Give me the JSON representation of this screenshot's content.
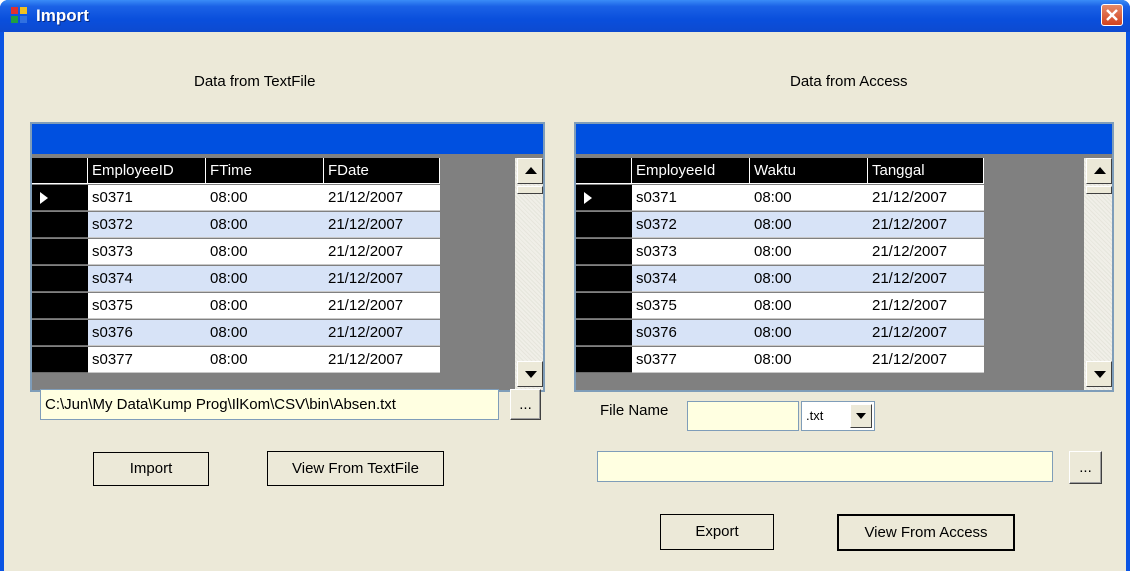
{
  "window": {
    "title": "Import"
  },
  "left": {
    "caption": "Data from TextFile",
    "columns": [
      "EmployeeID",
      "FTime",
      "FDate"
    ],
    "rows": [
      [
        "s0371",
        "08:00",
        "21/12/2007"
      ],
      [
        "s0372",
        "08:00",
        "21/12/2007"
      ],
      [
        "s0373",
        "08:00",
        "21/12/2007"
      ],
      [
        "s0374",
        "08:00",
        "21/12/2007"
      ],
      [
        "s0375",
        "08:00",
        "21/12/2007"
      ],
      [
        "s0376",
        "08:00",
        "21/12/2007"
      ],
      [
        "s0377",
        "08:00",
        "21/12/2007"
      ]
    ],
    "path_value": "C:\\Jun\\My Data\\Kump Prog\\IlKom\\CSV\\bin\\Absen.txt",
    "browse_label": "...",
    "import_label": "Import",
    "view_label": "View From TextFile"
  },
  "right": {
    "caption": "Data from Access",
    "columns": [
      "EmployeeId",
      "Waktu",
      "Tanggal"
    ],
    "rows": [
      [
        "s0371",
        "08:00",
        "21/12/2007"
      ],
      [
        "s0372",
        "08:00",
        "21/12/2007"
      ],
      [
        "s0373",
        "08:00",
        "21/12/2007"
      ],
      [
        "s0374",
        "08:00",
        "21/12/2007"
      ],
      [
        "s0375",
        "08:00",
        "21/12/2007"
      ],
      [
        "s0376",
        "08:00",
        "21/12/2007"
      ],
      [
        "s0377",
        "08:00",
        "21/12/2007"
      ]
    ],
    "file_name_label": "File Name",
    "file_name_value": "",
    "extension_selected": ".txt",
    "path_value": "",
    "browse_label": "...",
    "export_label": "Export",
    "view_label": "View From Access"
  },
  "icons": {
    "app": "window-app-icon",
    "close": "close-icon",
    "current_row": "row-pointer-icon"
  },
  "colors": {
    "titlebar": "#0a4fdc",
    "grid_caption": "#0050e0",
    "row_alt": "#d7e3f7",
    "textbox": "#ffffe1",
    "close": "#d2421e"
  }
}
